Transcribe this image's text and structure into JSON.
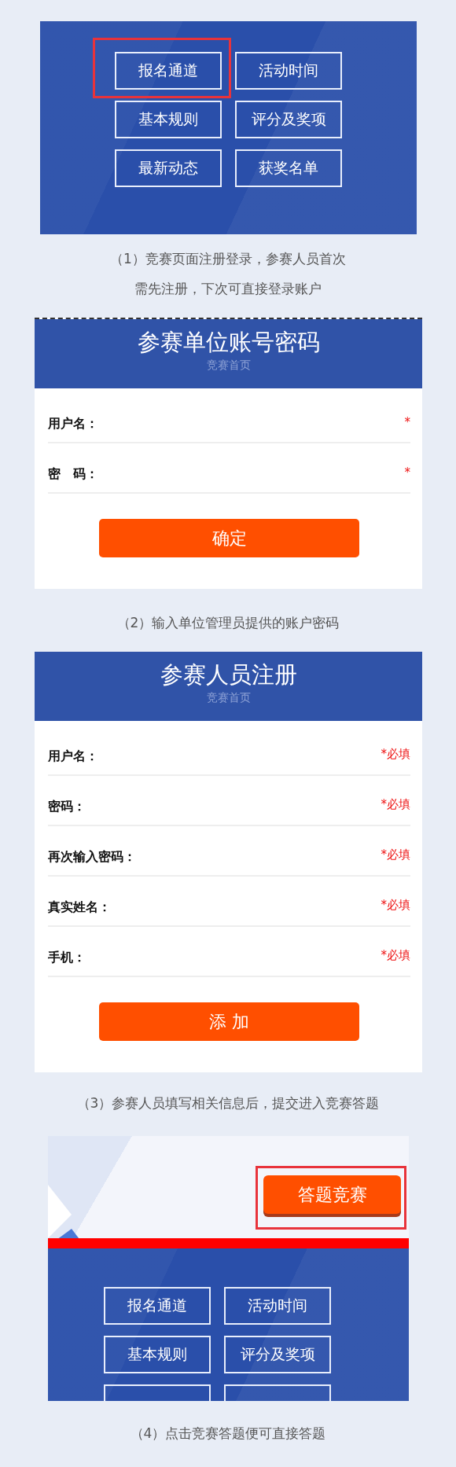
{
  "sections": [
    {
      "kind": "menu",
      "buttons": [
        {
          "label": "报名通道",
          "highlighted": true
        },
        {
          "label": "活动时间",
          "highlighted": false
        },
        {
          "label": "基本规则",
          "highlighted": false
        },
        {
          "label": "评分及奖项",
          "highlighted": false
        },
        {
          "label": "最新动态",
          "highlighted": false
        },
        {
          "label": "获奖名单",
          "highlighted": false
        }
      ],
      "caption": [
        "（1）竞赛页面注册登录，参赛人员首次",
        "需先注册，下次可直接登录账户"
      ]
    },
    {
      "kind": "form",
      "title": "参赛单位账号密码",
      "subtitle": "竞赛首页",
      "fields": [
        {
          "label": "用户名：",
          "required_mark": "*"
        },
        {
          "label": "密　码：",
          "required_mark": "*"
        }
      ],
      "submit": "确定",
      "caption": [
        "（2）输入单位管理员提供的账户密码"
      ]
    },
    {
      "kind": "form",
      "title": "参赛人员注册",
      "subtitle": "竞赛首页",
      "fields": [
        {
          "label": "用户名：",
          "required_mark": "*必填"
        },
        {
          "label": "密码：",
          "required_mark": "*必填"
        },
        {
          "label": "再次输入密码：",
          "required_mark": "*必填"
        },
        {
          "label": "真实姓名：",
          "required_mark": "*必填"
        },
        {
          "label": "手机：",
          "required_mark": "*必填"
        }
      ],
      "submit": "添 加",
      "caption": [
        "（3）参赛人员填写相关信息后，提交进入竞赛答题"
      ]
    },
    {
      "kind": "banner",
      "action": {
        "label": "答题竞赛",
        "highlighted": true
      },
      "buttons": [
        {
          "kind": "full",
          "label": "报名通道",
          "highlighted": false
        },
        {
          "kind": "full",
          "label": "活动时间",
          "highlighted": false
        },
        {
          "kind": "full",
          "label": "基本规则",
          "highlighted": false
        },
        {
          "kind": "full",
          "label": "评分及奖项",
          "highlighted": false
        },
        {
          "kind": "clipped",
          "highlighted": false
        },
        {
          "kind": "clipped",
          "highlighted": false
        }
      ],
      "caption": [
        "（4）点击竞赛答题便可直接答题"
      ]
    }
  ]
}
